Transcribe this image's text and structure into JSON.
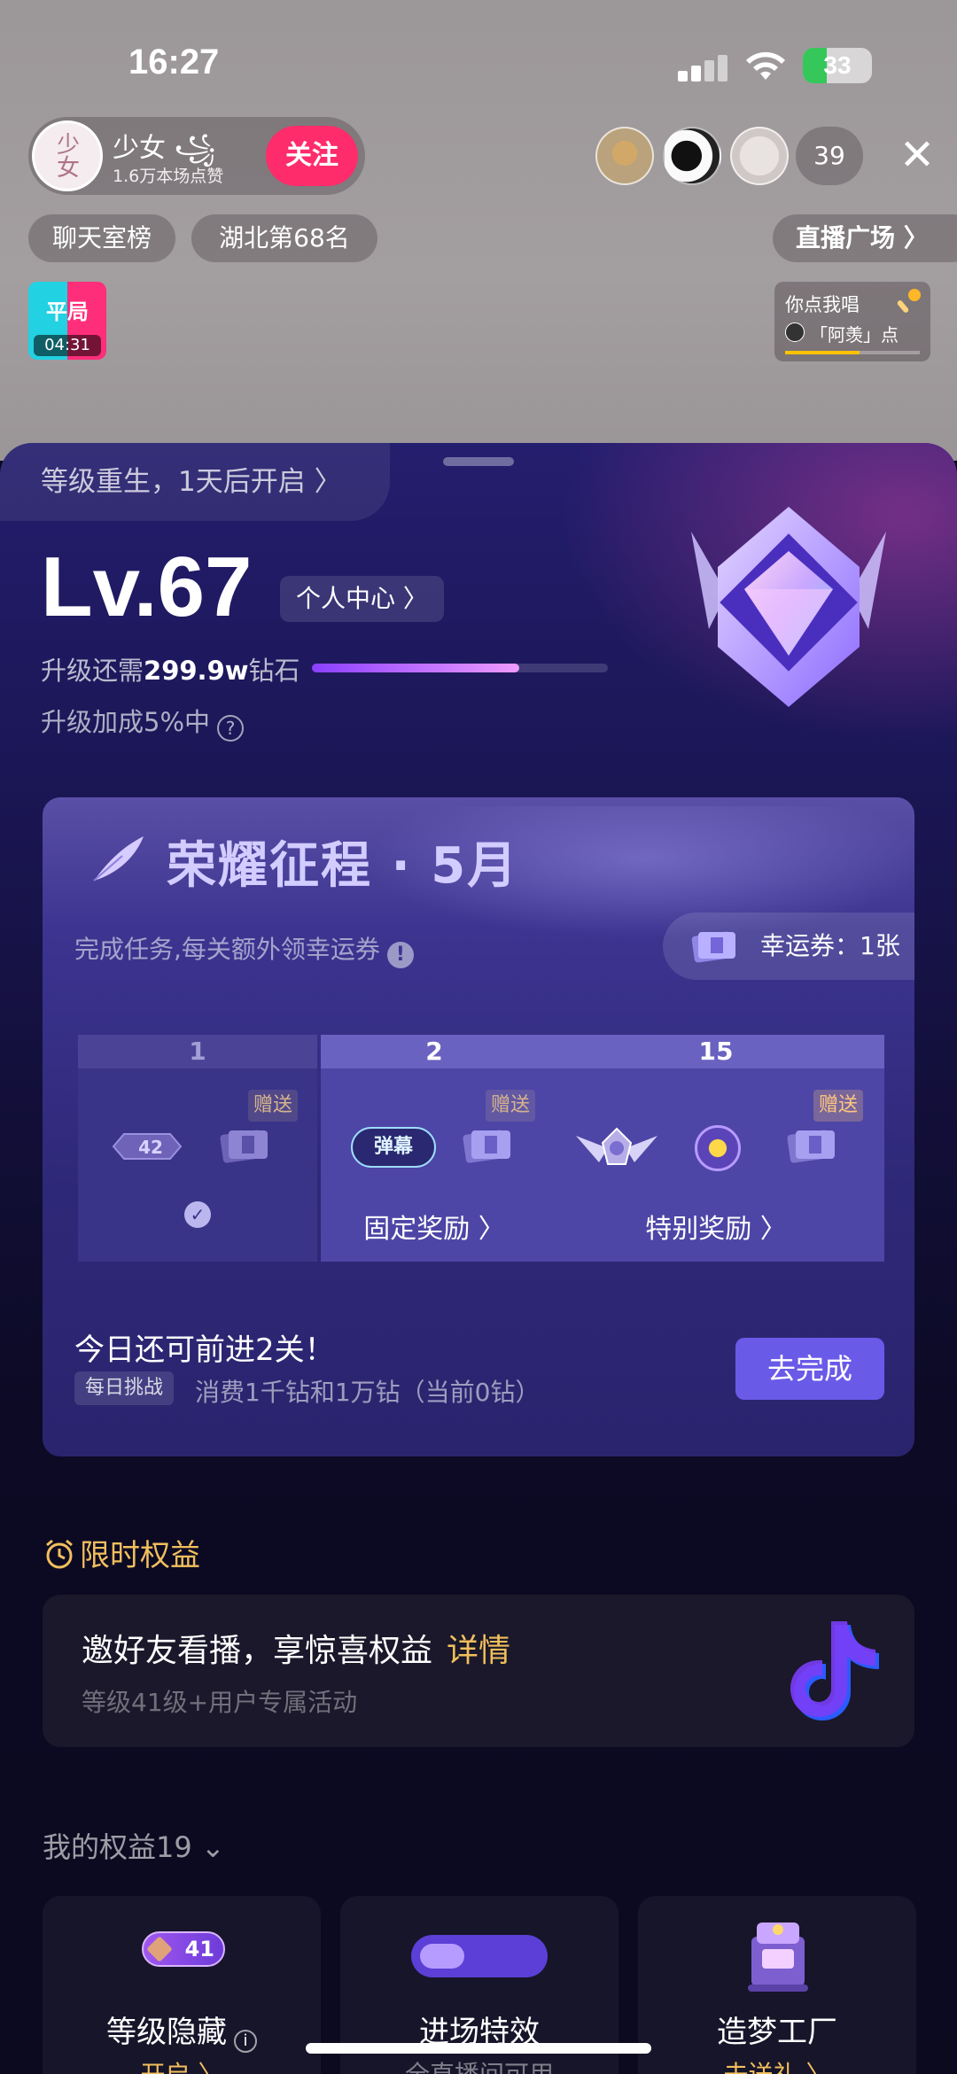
{
  "status_bar": {
    "time": "16:27",
    "battery": "33"
  },
  "live_room": {
    "host_name": "少女 ꧁",
    "host_avatar_text": "少女",
    "host_likes": "1.6万本场点赞",
    "follow_label": "关注",
    "viewer_count": "39",
    "tags": [
      "聊天室榜",
      "湖北第68名"
    ],
    "plaza_label": "直播广场 〉",
    "pk": {
      "label": "平局",
      "timer": "04:31"
    },
    "song": {
      "line1": "你点我唱",
      "line2": "「阿羡」点"
    }
  },
  "sheet": {
    "rebirth": "等级重生，1天后开启 〉",
    "level": "Lv.67",
    "personal_center": "个人中心 〉",
    "upgrade_prefix": "升级还需",
    "upgrade_amount": "299.9w",
    "upgrade_suffix": "钻石",
    "level_progress": 0.7,
    "upgrade_bonus": "升级加成5%中",
    "honor": {
      "title": "荣耀征程 · 5月",
      "subtitle": "完成任务,每关额外领幸运券",
      "coupon": "幸运券：1张",
      "stages": [
        {
          "number": "1",
          "gift_tag": "赠送",
          "lv_badge": "42",
          "completed": true
        },
        {
          "number": "2",
          "gift_tag": "赠送",
          "danmu_label": "弹幕",
          "label": "固定奖励 〉"
        },
        {
          "number": "15",
          "gift_tag": "赠送",
          "label": "特别奖励 〉"
        }
      ],
      "today_text": "今日还可前进2关！",
      "daily_tag": "每日挑战",
      "daily_desc": "消费1千钻和1万钻（当前0钻）",
      "go_label": "去完成"
    },
    "limited": {
      "title": "限时权益",
      "invite_title": "邀好友看播，享惊喜权益",
      "invite_detail": "详情",
      "invite_sub": "等级41级+用户专属活动"
    },
    "my_rights_title": "我的权益19",
    "rights": [
      {
        "name": "等级隐藏",
        "badge": "41",
        "sub": "开启 〉"
      },
      {
        "name": "进场特效",
        "sub": "全直播间可用"
      },
      {
        "name": "造梦工厂",
        "sub": "去送礼 〉"
      }
    ]
  },
  "colors": {
    "follow": "#fe2c6b",
    "accent_gold": "#f1bf5c",
    "primary_button": "#6a5ae8",
    "sheet_top": "#241e6e",
    "sheet_bottom": "#0b0a1f"
  }
}
